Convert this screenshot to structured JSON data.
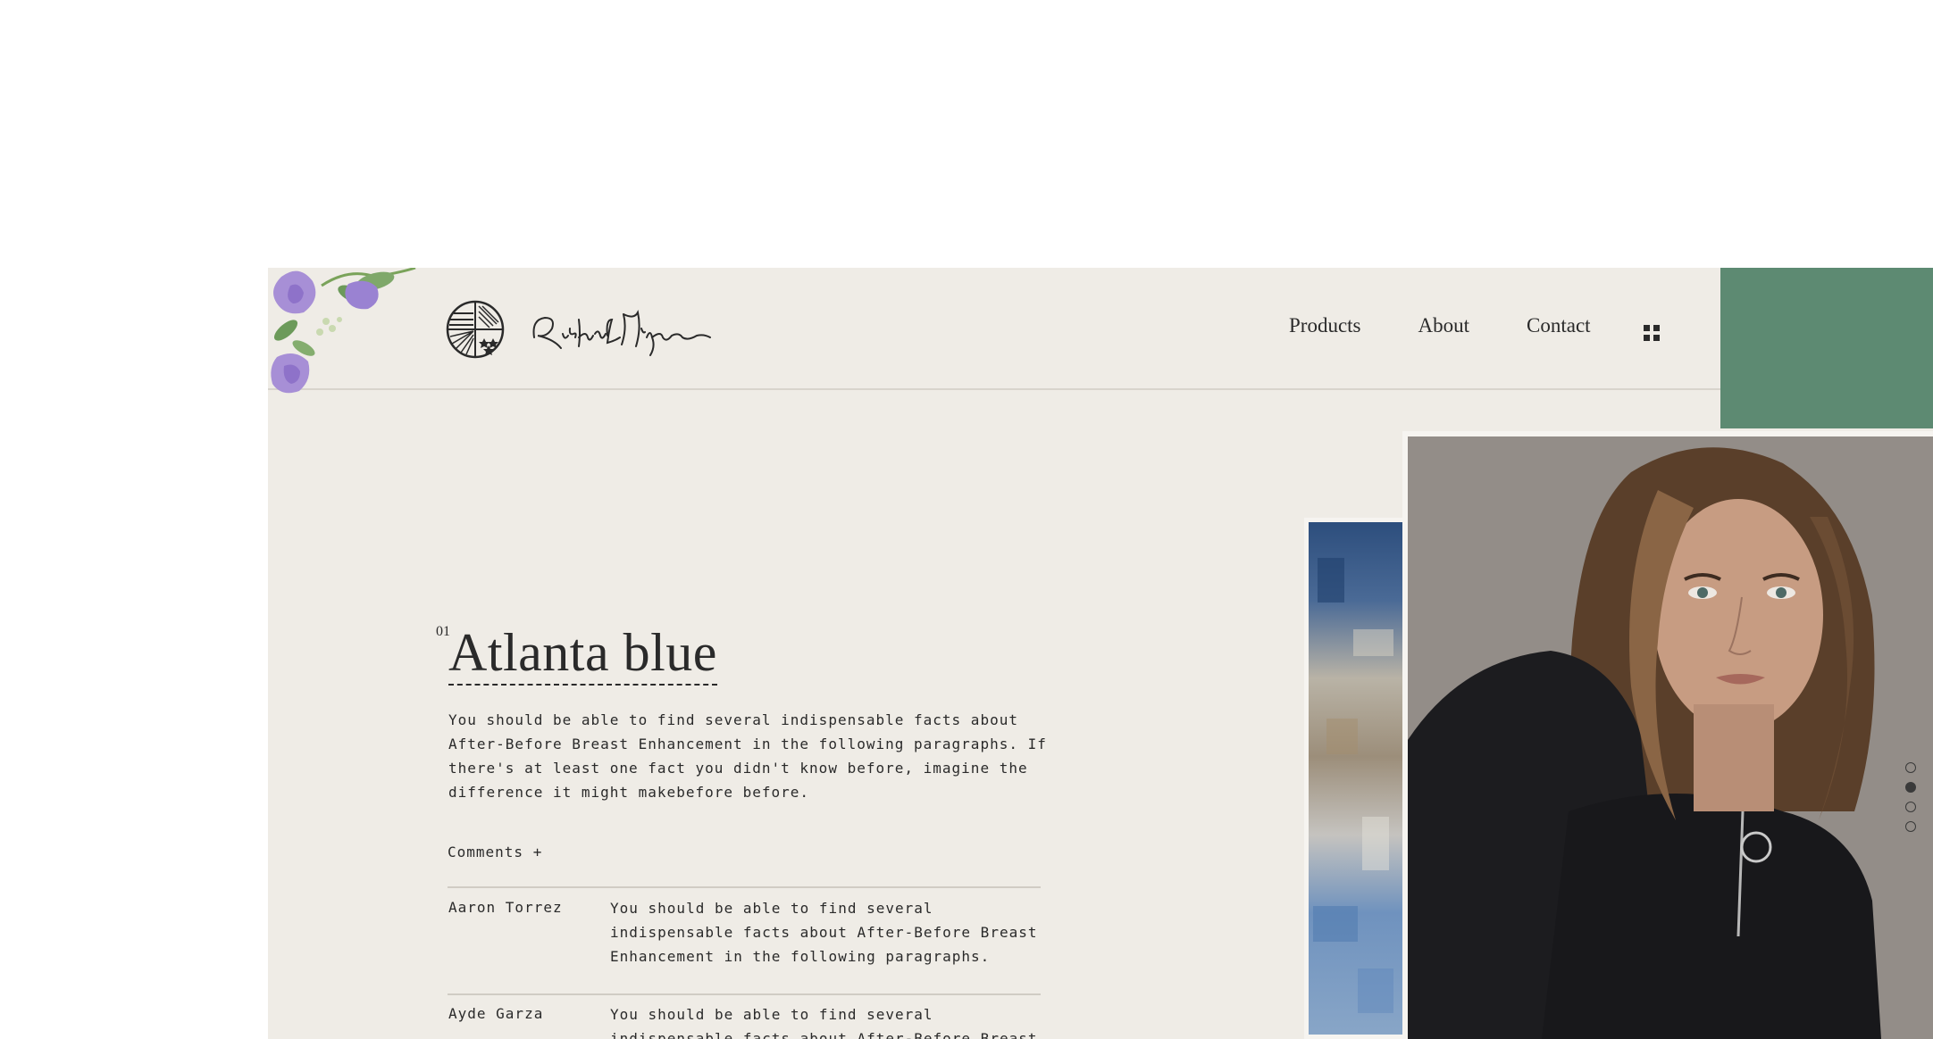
{
  "nav": {
    "items": [
      "Products",
      "About",
      "Contact"
    ]
  },
  "article": {
    "number": "01",
    "title": "Atlanta blue",
    "body": "You should be able to find several indispensable facts about After-Before Breast Enhancement in the following paragraphs. If there's at least one fact you didn't know before, imagine the difference it might makebefore before."
  },
  "comments": {
    "toggle_label": "Comments +",
    "items": [
      {
        "author": "Aaron Torrez",
        "text": "You should be able to find several indispensable facts about After-Before Breast Enhancement in the following paragraphs."
      },
      {
        "author": "Ayde Garza",
        "text": "You should be able to find several indispensable facts about After-Before Breast Enhancement in the following paragraphs."
      }
    ]
  },
  "slider": {
    "count": 4,
    "active_index": 1
  },
  "colors": {
    "background": "#efece6",
    "accent_green": "#5d8a72",
    "text": "#2a2a2a"
  },
  "icons": [
    "logo-emblem-icon",
    "menu-grid-icon",
    "flower-decoration"
  ]
}
